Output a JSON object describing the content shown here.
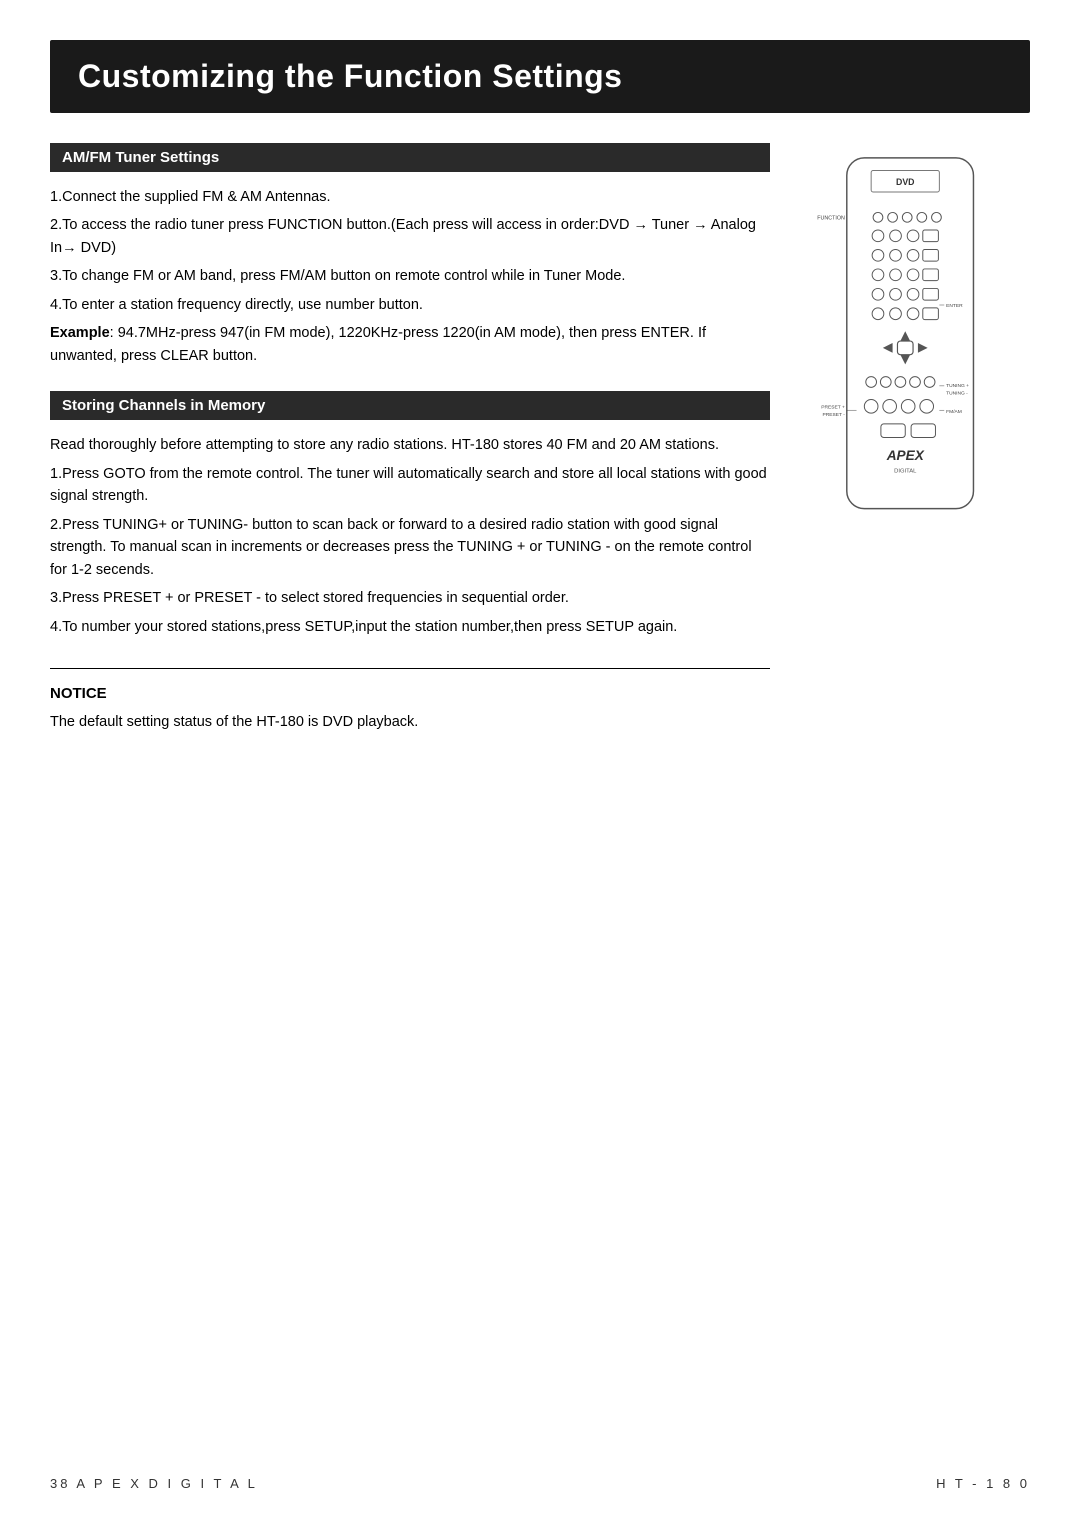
{
  "page": {
    "title": "Customizing the Function Settings",
    "sections": [
      {
        "id": "amfm-tuner",
        "header": "AM/FM Tuner Settings",
        "paragraphs": [
          "1.Connect the supplied FM & AM Antennas.",
          "2.To access the radio tuner press FUNCTION button.(Each press will access in order:DVD → Tuner → Analog In→ DVD)",
          "3.To change FM or AM band, press FM/AM button on remote control while in Tuner Mode.",
          "4.To enter a station frequency directly, use number button.",
          "Example: 94.7MHz-press 947(in FM mode), 1220KHz-press 1220(in AM mode), then press ENTER. If unwanted, press CLEAR button."
        ],
        "example_bold": "Example"
      },
      {
        "id": "storing-channels",
        "header": "Storing Channels in Memory",
        "paragraphs": [
          "Read thoroughly before attempting to store any radio stations. HT-180 stores 40 FM and 20 AM stations.",
          "1.Press GOTO from the remote control. The tuner will automatically search and store all local stations with good signal strength.",
          "2.Press TUNING+ or TUNING- button to scan back or forward to a desired radio station with good signal strength. To manual scan in increments or decreases press the TUNING + or TUNING - on the remote control for 1-2 seconds.",
          "3.Press PRESET + or PRESET - to select stored frequencies in sequential order.",
          "4.To number your stored stations,press SETUP,input the station number,then press SETUP again."
        ]
      }
    ],
    "notice": {
      "title": "NOTICE",
      "text": "The default setting status of the HT-180 is DVD playback."
    },
    "footer": {
      "left": "38   A P E X   D I G I T A L",
      "right": "H T - 1 8 0"
    }
  }
}
